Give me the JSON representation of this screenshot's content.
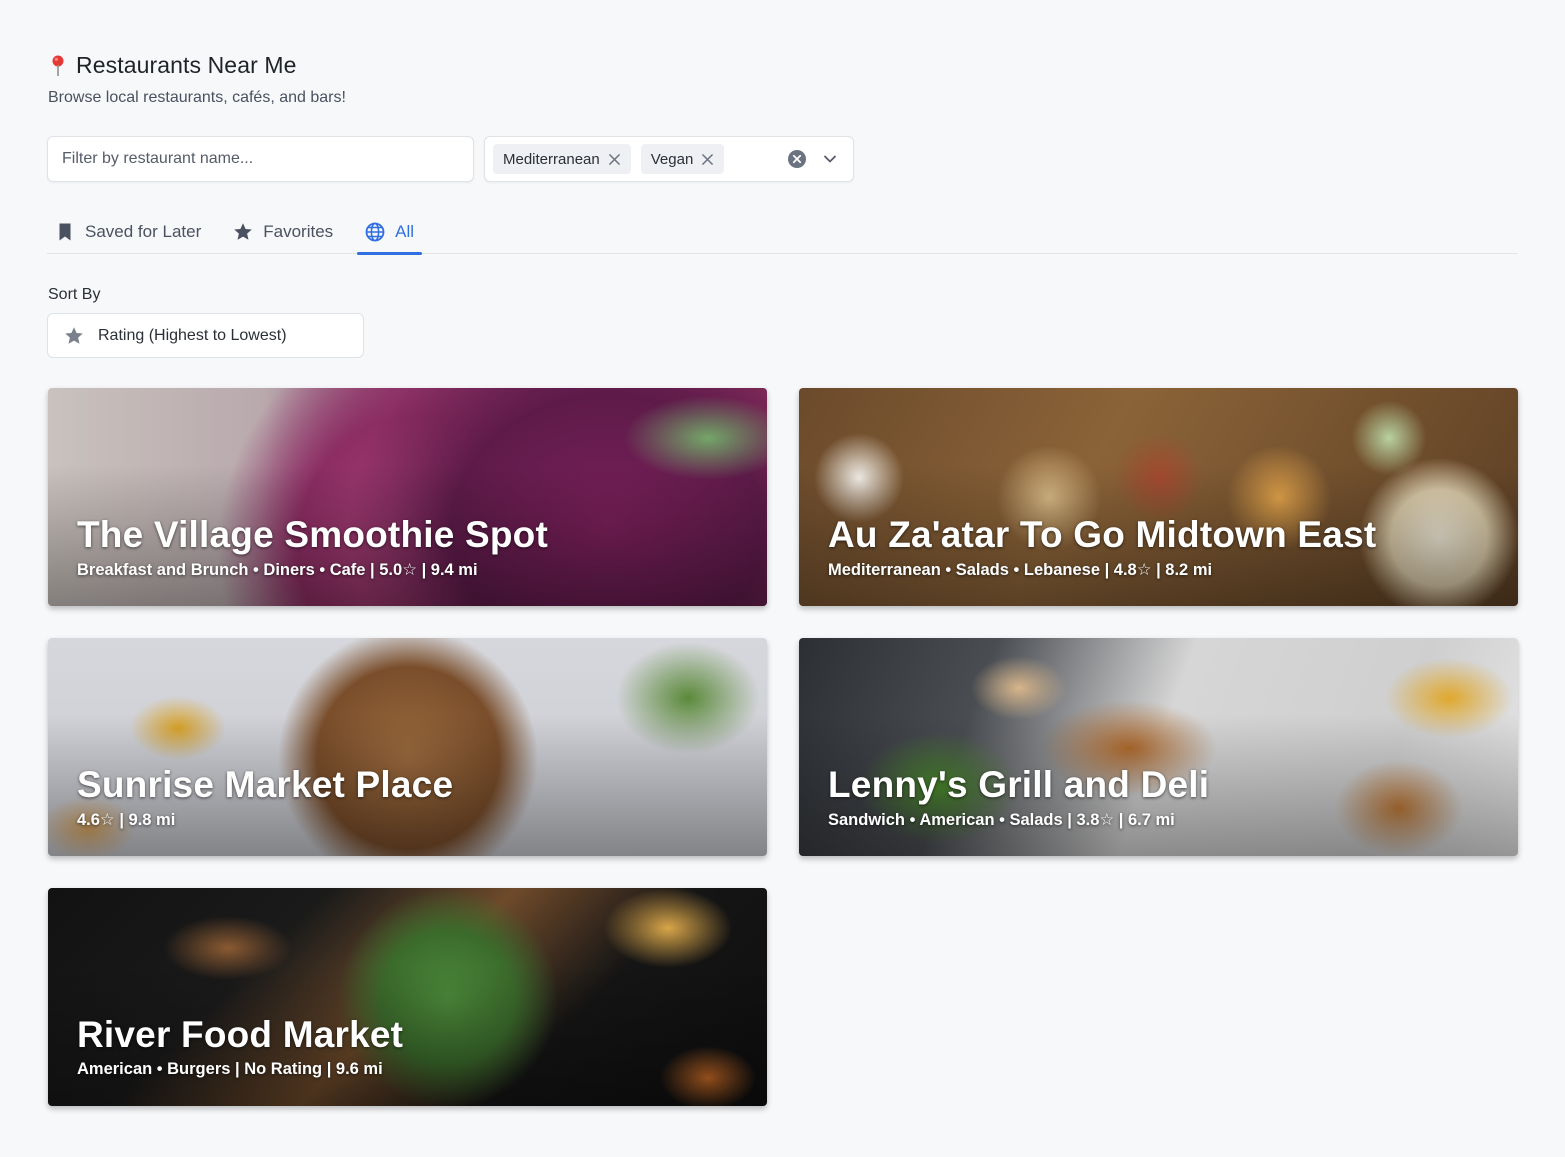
{
  "header": {
    "title": "Restaurants Near Me",
    "subtitle": "Browse local restaurants, cafés, and bars!",
    "icon": "map-pin-icon",
    "icon_color": "#e53935"
  },
  "filters": {
    "name_placeholder": "Filter by restaurant name...",
    "name_value": "",
    "cuisine_chips": [
      {
        "label": "Mediterranean"
      },
      {
        "label": "Vegan"
      }
    ]
  },
  "tabs": [
    {
      "label": "Saved for Later",
      "icon": "bookmark-icon",
      "active": false
    },
    {
      "label": "Favorites",
      "icon": "star-icon",
      "active": false
    },
    {
      "label": "All",
      "icon": "globe-icon",
      "active": true
    }
  ],
  "sort": {
    "label": "Sort By",
    "value": "Rating (Highest to Lowest)",
    "icon": "star-icon"
  },
  "restaurants": [
    {
      "name": "The Village Smoothie Spot",
      "meta": "Breakfast and Brunch • Diners • Cafe | 5.0☆ | 9.4 mi"
    },
    {
      "name": "Au Za'atar To Go Midtown East",
      "meta": "Mediterranean • Salads • Lebanese | 4.8☆ | 8.2 mi"
    },
    {
      "name": "Sunrise Market Place",
      "meta": "4.6☆ | 9.8 mi"
    },
    {
      "name": "Lenny's Grill and Deli",
      "meta": "Sandwich • American • Salads | 3.8☆ | 6.7 mi"
    },
    {
      "name": "River Food Market",
      "meta": "American • Burgers | No Rating | 9.6 mi"
    }
  ],
  "colors": {
    "accent": "#2f6fe0",
    "background": "#f7f8fa"
  }
}
